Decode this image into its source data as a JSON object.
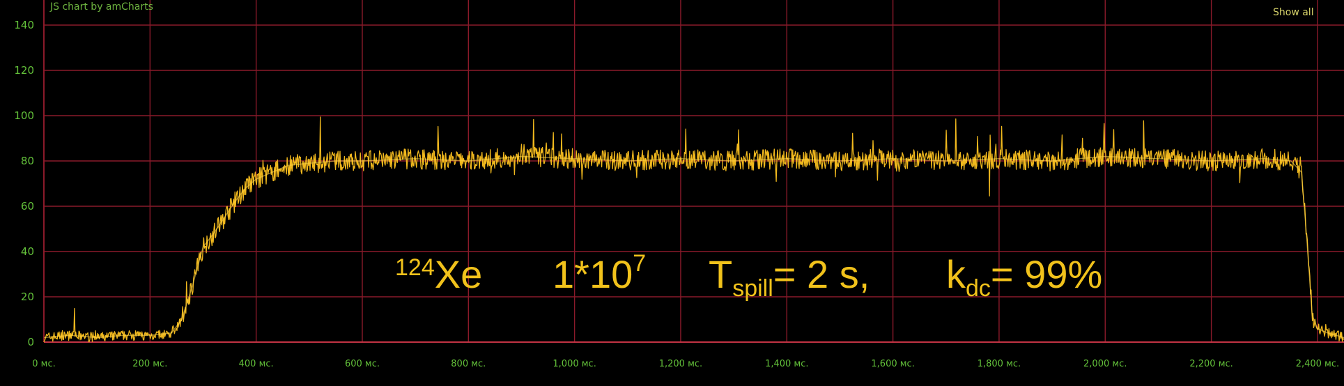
{
  "credit": "JS chart by amCharts",
  "show_all_label": "Show all",
  "annotation": {
    "isotope_mass": "124",
    "isotope_symbol": "Xe",
    "intensity_base": "1*10",
    "intensity_exp": "7",
    "tspill_main": "T",
    "tspill_sub": "spill",
    "tspill_value": "= 2 s,",
    "kdc_main": "k",
    "kdc_sub": "dc",
    "kdc_value": "= 99%"
  },
  "colors": {
    "background": "#000000",
    "grid": "#8a1a2a",
    "line": "#f0b81e",
    "line_highlight": "#ffd64a",
    "axis_labels": "#63c13a",
    "annotation": "#f1c21b"
  },
  "chart_data": {
    "type": "line",
    "xlabel": "",
    "ylabel": "",
    "xlim": [
      0,
      2450
    ],
    "ylim": [
      0,
      140
    ],
    "x_unit": "мс.",
    "grid": true,
    "x_ticks": [
      0,
      200,
      400,
      600,
      800,
      1000,
      1200,
      1400,
      1600,
      1800,
      2000,
      2200,
      2400
    ],
    "x_tick_labels": [
      "0 мс.",
      "200 мс.",
      "400 мс.",
      "600 мс.",
      "800 мс.",
      "1,000 мс.",
      "1,200 мс.",
      "1,400 мс.",
      "1,600 мс.",
      "1,800 мс.",
      "2,000 мс.",
      "2,200 мс.",
      "2,400 мс."
    ],
    "y_ticks": [
      0,
      20,
      40,
      60,
      80,
      100,
      120,
      140
    ],
    "y_tick_labels": [
      "0",
      "20",
      "40",
      "60",
      "80",
      "100",
      "120",
      "140"
    ],
    "series": [
      {
        "x": [
          0,
          50,
          100,
          150,
          200,
          240,
          260,
          280,
          300,
          320,
          340,
          360,
          380,
          400,
          430,
          460,
          500,
          550,
          600,
          700,
          800,
          900,
          1000,
          1100,
          1200,
          1300,
          1400,
          1500,
          1600,
          1700,
          1800,
          1900,
          2000,
          2100,
          2200,
          2300,
          2350,
          2370,
          2380,
          2390,
          2400,
          2420,
          2450
        ],
        "y": [
          2,
          3,
          2,
          3,
          3,
          4,
          10,
          25,
          42,
          48,
          55,
          62,
          68,
          72,
          75,
          78,
          79,
          80,
          80,
          81,
          80,
          82,
          81,
          80,
          81,
          80,
          81,
          80,
          81,
          80,
          81,
          80,
          82,
          81,
          80,
          81,
          80,
          75,
          45,
          12,
          6,
          4,
          2
        ]
      }
    ]
  }
}
